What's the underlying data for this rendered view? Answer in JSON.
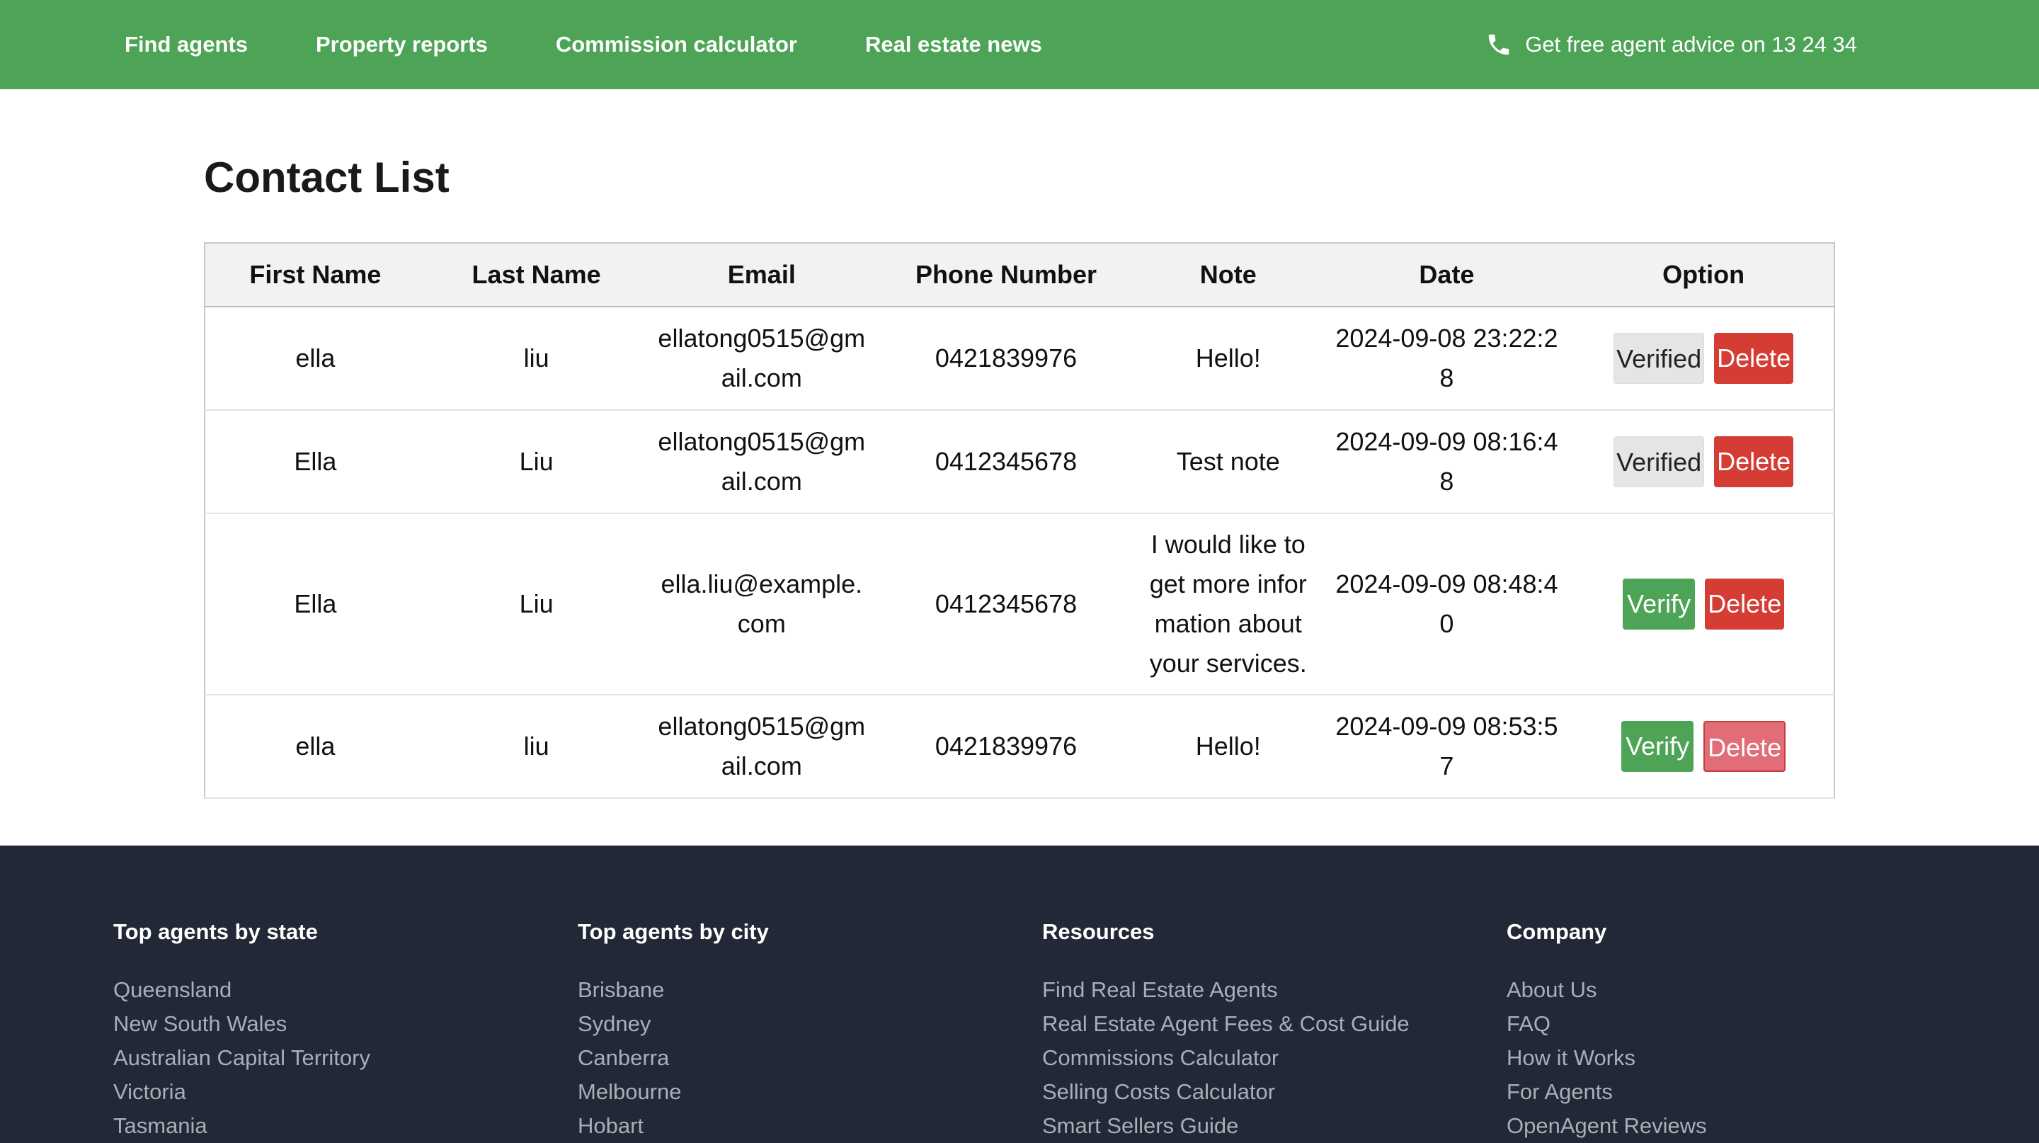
{
  "nav": {
    "links": [
      "Find agents",
      "Property reports",
      "Commission calculator",
      "Real estate news"
    ],
    "advice_text": "Get free agent advice on 13 24 34"
  },
  "page": {
    "title": "Contact List"
  },
  "table": {
    "headers": [
      "First Name",
      "Last Name",
      "Email",
      "Phone Number",
      "Note",
      "Date",
      "Option"
    ],
    "rows": [
      {
        "first": "ella",
        "last": "liu",
        "email": "ellatong0515@gmail.com",
        "phone": "0421839976",
        "note": "Hello!",
        "date": "2024-09-08 23:22:28",
        "status_label": "Verified",
        "delete_label": "Delete"
      },
      {
        "first": "Ella",
        "last": "Liu",
        "email": "ellatong0515@gmail.com",
        "phone": "0412345678",
        "note": "Test note",
        "date": "2024-09-09 08:16:48",
        "status_label": "Verified",
        "delete_label": "Delete"
      },
      {
        "first": "Ella",
        "last": "Liu",
        "email": "ella.liu@example.com",
        "phone": "0412345678",
        "note": "I would like to get more information about your services.",
        "date": "2024-09-09 08:48:40",
        "status_label": "Verify",
        "delete_label": "Delete"
      },
      {
        "first": "ella",
        "last": "liu",
        "email": "ellatong0515@gmail.com",
        "phone": "0421839976",
        "note": "Hello!",
        "date": "2024-09-09 08:53:57",
        "status_label": "Verify",
        "delete_label": "Delete"
      }
    ]
  },
  "footer": {
    "columns": [
      {
        "title": "Top agents by state",
        "items": [
          "Queensland",
          "New South Wales",
          "Australian Capital Territory",
          "Victoria",
          "Tasmania"
        ]
      },
      {
        "title": "Top agents by city",
        "items": [
          "Brisbane",
          "Sydney",
          "Canberra",
          "Melbourne",
          "Hobart"
        ]
      },
      {
        "title": "Resources",
        "items": [
          "Find Real Estate Agents",
          "Real Estate Agent Fees & Cost Guide",
          "Commissions Calculator",
          "Selling Costs Calculator",
          "Smart Sellers Guide"
        ]
      },
      {
        "title": "Company",
        "items": [
          "About Us",
          "FAQ",
          "How it Works",
          "For Agents",
          "OpenAgent Reviews"
        ]
      }
    ]
  },
  "colors": {
    "nav_green": "#4ea456",
    "delete_red": "#d43c34",
    "footer_bg": "#222836"
  },
  "icons": {
    "advice": "phone-icon"
  }
}
